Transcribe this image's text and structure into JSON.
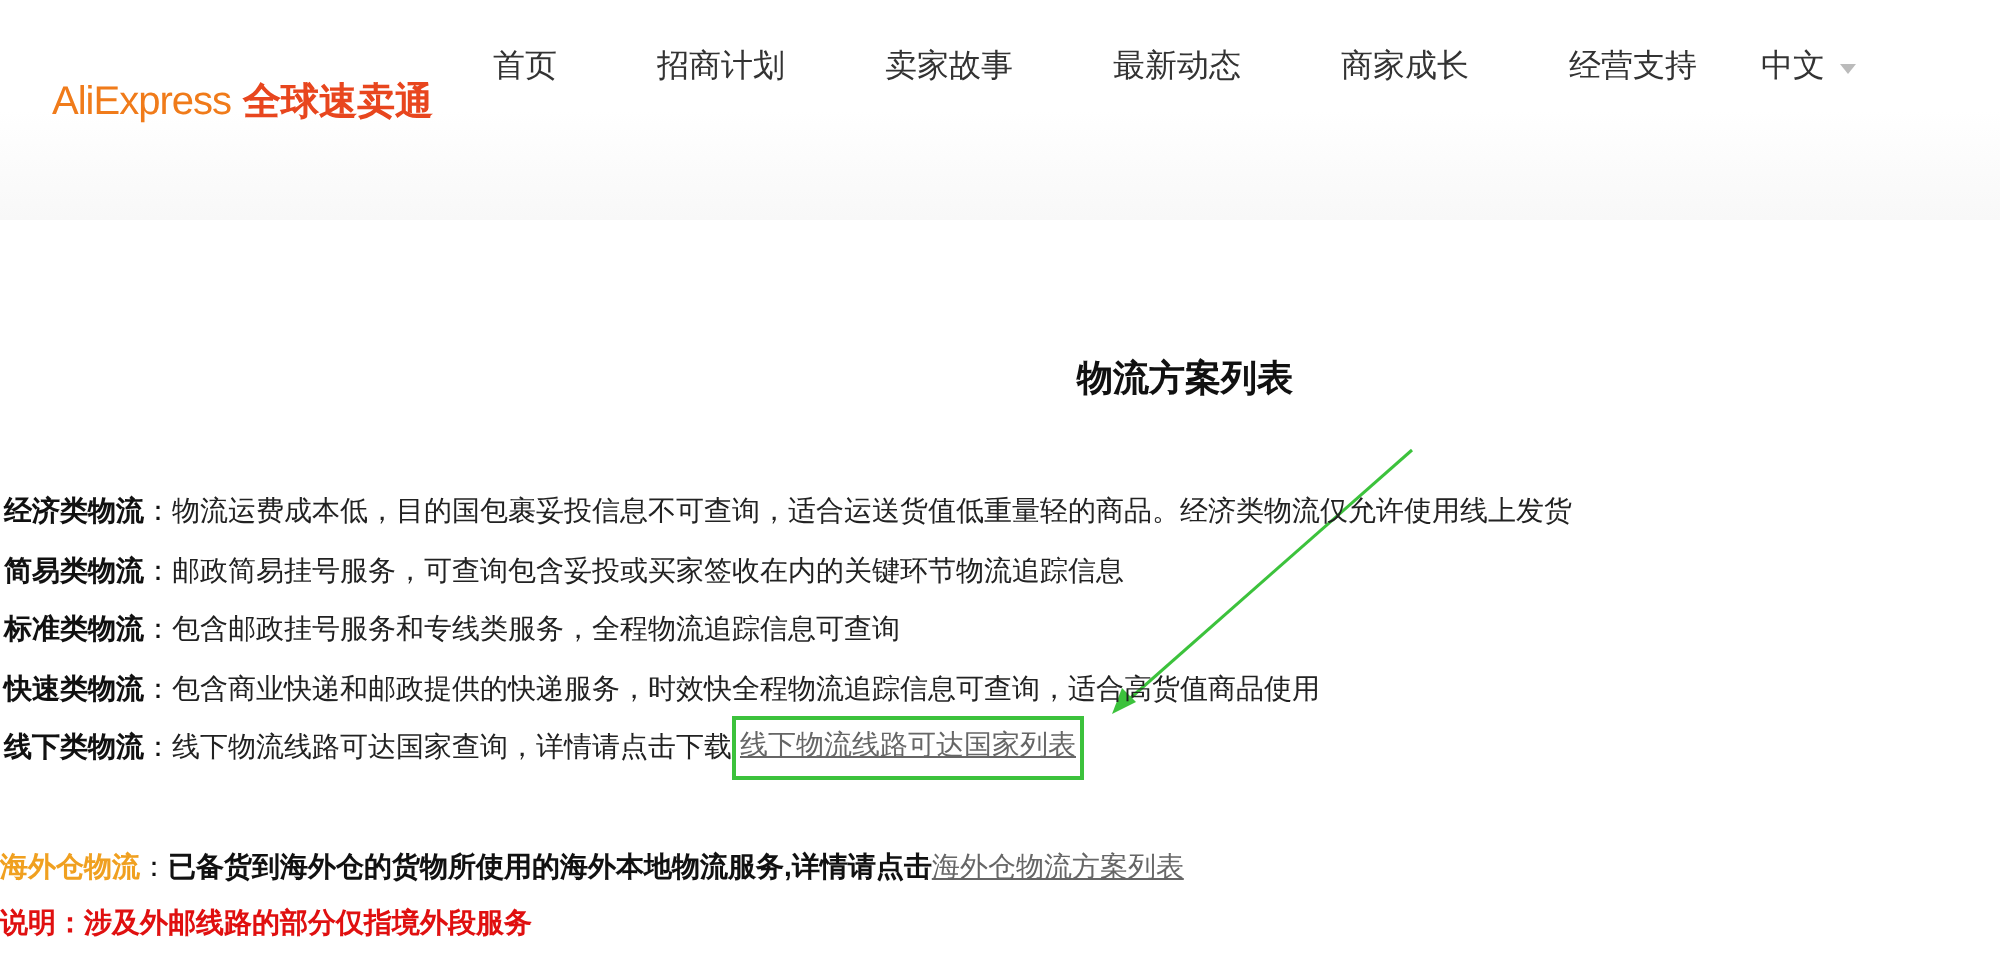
{
  "header": {
    "logo": {
      "brand": "AliExpress",
      "name": "全球速卖通"
    },
    "nav": [
      {
        "label": "首页"
      },
      {
        "label": "招商计划"
      },
      {
        "label": "卖家故事"
      },
      {
        "label": "最新动态"
      },
      {
        "label": "商家成长"
      },
      {
        "label": "经营支持"
      }
    ],
    "language": "中文"
  },
  "title": "物流方案列表",
  "categories": [
    {
      "label": "经济类物流",
      "separator": "：",
      "description": "物流运费成本低，目的国包裹妥投信息不可查询，适合运送货值低重量轻的商品。经济类物流仅允许使用线上发货"
    },
    {
      "label": "简易类物流",
      "separator": "：",
      "description": "邮政简易挂号服务，可查询包含妥投或买家签收在内的关键环节物流追踪信息"
    },
    {
      "label": "标准类物流",
      "separator": "：",
      "description": "包含邮政挂号服务和专线类服务，全程物流追踪信息可查询"
    },
    {
      "label": "快速类物流",
      "separator": "：",
      "description": "包含商业快递和邮政提供的快递服务，时效快全程物流追踪信息可查询，适合高货值商品使用"
    },
    {
      "label": "线下类物流",
      "separator": "：",
      "description": "线下物流线路可达国家查询，详情请点击下载",
      "link": "线下物流线路可达国家列表",
      "highlighted": true
    }
  ],
  "overseas": {
    "label": "海外仓物流",
    "separator": "：",
    "description": "已备货到海外仓的货物所使用的海外本地物流服务,详情请点击",
    "link": "海外仓物流方案列表"
  },
  "note": "说明：涉及外邮线路的部分仅指境外段服务"
}
